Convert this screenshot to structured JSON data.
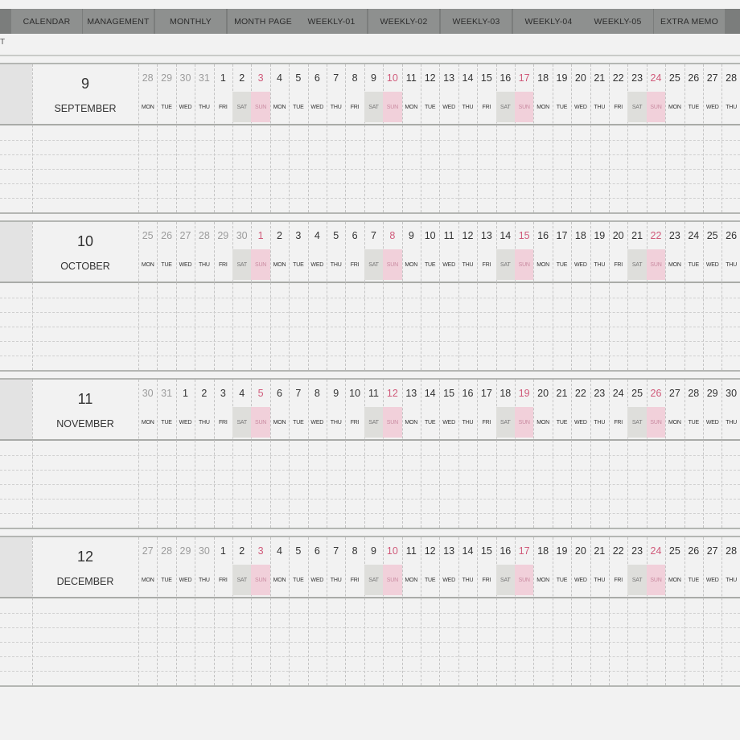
{
  "tabs": [
    "CALENDAR",
    "MANAGEMENT",
    "MONTHLY",
    "MONTH PAGE",
    "WEEKLY-01",
    "WEEKLY-02",
    "WEEKLY-03",
    "WEEKLY-04",
    "WEEKLY-05",
    "EXTRA MEMO"
  ],
  "subrow_label": "T",
  "months": [
    {
      "number": "9",
      "name": "SEPTEMBER",
      "days": [
        "28",
        "29",
        "30",
        "31",
        "1",
        "2",
        "3",
        "4",
        "5",
        "6",
        "7",
        "8",
        "9",
        "10",
        "11",
        "12",
        "13",
        "14",
        "15",
        "16",
        "17",
        "18",
        "19",
        "20",
        "21",
        "22",
        "23",
        "24",
        "25",
        "26",
        "27",
        "28"
      ],
      "prev_count": 4,
      "weekdays": [
        "MON",
        "TUE",
        "WED",
        "THU",
        "FRI",
        "SAT",
        "SUN",
        "MON",
        "TUE",
        "WED",
        "THU",
        "FRI",
        "SAT",
        "SUN",
        "MON",
        "TUE",
        "WED",
        "THU",
        "FRI",
        "SAT",
        "SUN",
        "MON",
        "TUE",
        "WED",
        "THU",
        "FRI",
        "SAT",
        "SUN",
        "MON",
        "TUE",
        "WED",
        "THU"
      ]
    },
    {
      "number": "10",
      "name": "OCTOBER",
      "days": [
        "25",
        "26",
        "27",
        "28",
        "29",
        "30",
        "1",
        "2",
        "3",
        "4",
        "5",
        "6",
        "7",
        "8",
        "9",
        "10",
        "11",
        "12",
        "13",
        "14",
        "15",
        "16",
        "17",
        "18",
        "19",
        "20",
        "21",
        "22",
        "23",
        "24",
        "25",
        "26"
      ],
      "prev_count": 6,
      "weekdays": [
        "MON",
        "TUE",
        "WED",
        "THU",
        "FRI",
        "SAT",
        "SUN",
        "MON",
        "TUE",
        "WED",
        "THU",
        "FRI",
        "SAT",
        "SUN",
        "MON",
        "TUE",
        "WED",
        "THU",
        "FRI",
        "SAT",
        "SUN",
        "MON",
        "TUE",
        "WED",
        "THU",
        "FRI",
        "SAT",
        "SUN",
        "MON",
        "TUE",
        "WED",
        "THU"
      ]
    },
    {
      "number": "11",
      "name": "NOVEMBER",
      "days": [
        "30",
        "31",
        "1",
        "2",
        "3",
        "4",
        "5",
        "6",
        "7",
        "8",
        "9",
        "10",
        "11",
        "12",
        "13",
        "14",
        "15",
        "16",
        "17",
        "18",
        "19",
        "20",
        "21",
        "22",
        "23",
        "24",
        "25",
        "26",
        "27",
        "28",
        "29",
        "30"
      ],
      "prev_count": 2,
      "weekdays": [
        "MON",
        "TUE",
        "WED",
        "THU",
        "FRI",
        "SAT",
        "SUN",
        "MON",
        "TUE",
        "WED",
        "THU",
        "FRI",
        "SAT",
        "SUN",
        "MON",
        "TUE",
        "WED",
        "THU",
        "FRI",
        "SAT",
        "SUN",
        "MON",
        "TUE",
        "WED",
        "THU",
        "FRI",
        "SAT",
        "SUN",
        "MON",
        "TUE",
        "WED",
        "THU"
      ]
    },
    {
      "number": "12",
      "name": "DECEMBER",
      "days": [
        "27",
        "28",
        "29",
        "30",
        "1",
        "2",
        "3",
        "4",
        "5",
        "6",
        "7",
        "8",
        "9",
        "10",
        "11",
        "12",
        "13",
        "14",
        "15",
        "16",
        "17",
        "18",
        "19",
        "20",
        "21",
        "22",
        "23",
        "24",
        "25",
        "26",
        "27",
        "28"
      ],
      "prev_count": 4,
      "weekdays": [
        "MON",
        "TUE",
        "WED",
        "THU",
        "FRI",
        "SAT",
        "SUN",
        "MON",
        "TUE",
        "WED",
        "THU",
        "FRI",
        "SAT",
        "SUN",
        "MON",
        "TUE",
        "WED",
        "THU",
        "FRI",
        "SAT",
        "SUN",
        "MON",
        "TUE",
        "WED",
        "THU",
        "FRI",
        "SAT",
        "SUN",
        "MON",
        "TUE",
        "WED",
        "THU"
      ]
    }
  ],
  "colors": {
    "sunday_text": "#d05a7a",
    "sunday_bg": "#f1d0da",
    "saturday_bg": "#dededb",
    "prev_month_text": "#9c9c9c"
  }
}
